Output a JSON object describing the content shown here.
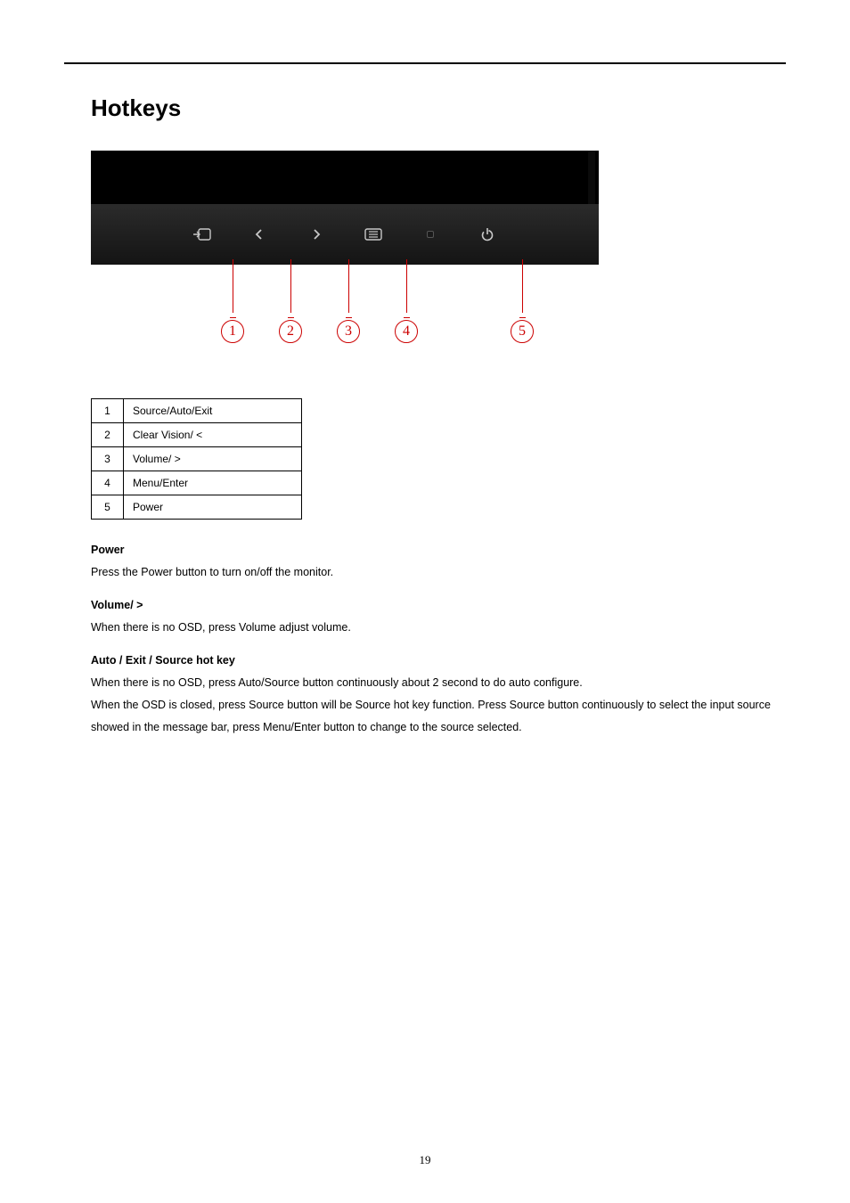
{
  "title": "Hotkeys",
  "callouts": {
    "n1": "1",
    "n2": "2",
    "n3": "3",
    "n4": "4",
    "n5": "5"
  },
  "table": {
    "rows": [
      {
        "idx": "1",
        "desc": "Source/Auto/Exit"
      },
      {
        "idx": "2",
        "desc": "Clear Vision/ <"
      },
      {
        "idx": "3",
        "desc": "Volume/ >"
      },
      {
        "idx": "4",
        "desc": "Menu/Enter"
      },
      {
        "idx": "5",
        "desc": "Power"
      }
    ]
  },
  "sections": {
    "power_h": "Power",
    "power_p": "Press the Power button to turn on/off the monitor.",
    "volume_h": "Volume/ >",
    "volume_p": "When there is no OSD, press Volume adjust volume.",
    "auto_h": "Auto / Exit / Source hot key",
    "auto_p1": "When there is no OSD, press Auto/Source button continuously about 2 second to do auto configure.",
    "auto_p2": "When the OSD is closed, press Source button will be Source hot key function. Press Source button continuously to select the input source showed in the message bar, press Menu/Enter button to change to the source selected."
  },
  "page_number": "19"
}
